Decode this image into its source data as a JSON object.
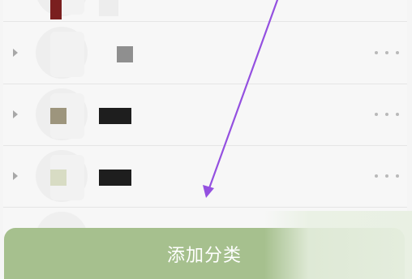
{
  "list": {
    "rows": [
      {
        "thumb_color": "#7a1f1f"
      },
      {
        "thumb_color": "#8f8f8f"
      },
      {
        "thumb_color": "#9d957d"
      },
      {
        "thumb_color": "#d8dcc4"
      }
    ],
    "name_block_color": "#1e1e1e"
  },
  "footer": {
    "add_category_label": "添加分类"
  },
  "colors": {
    "accent_green": "#a6c08e",
    "annotation_arrow": "#9450e0"
  },
  "icons": {
    "expand": "chevron-right-icon",
    "more": "more-dots-icon"
  }
}
